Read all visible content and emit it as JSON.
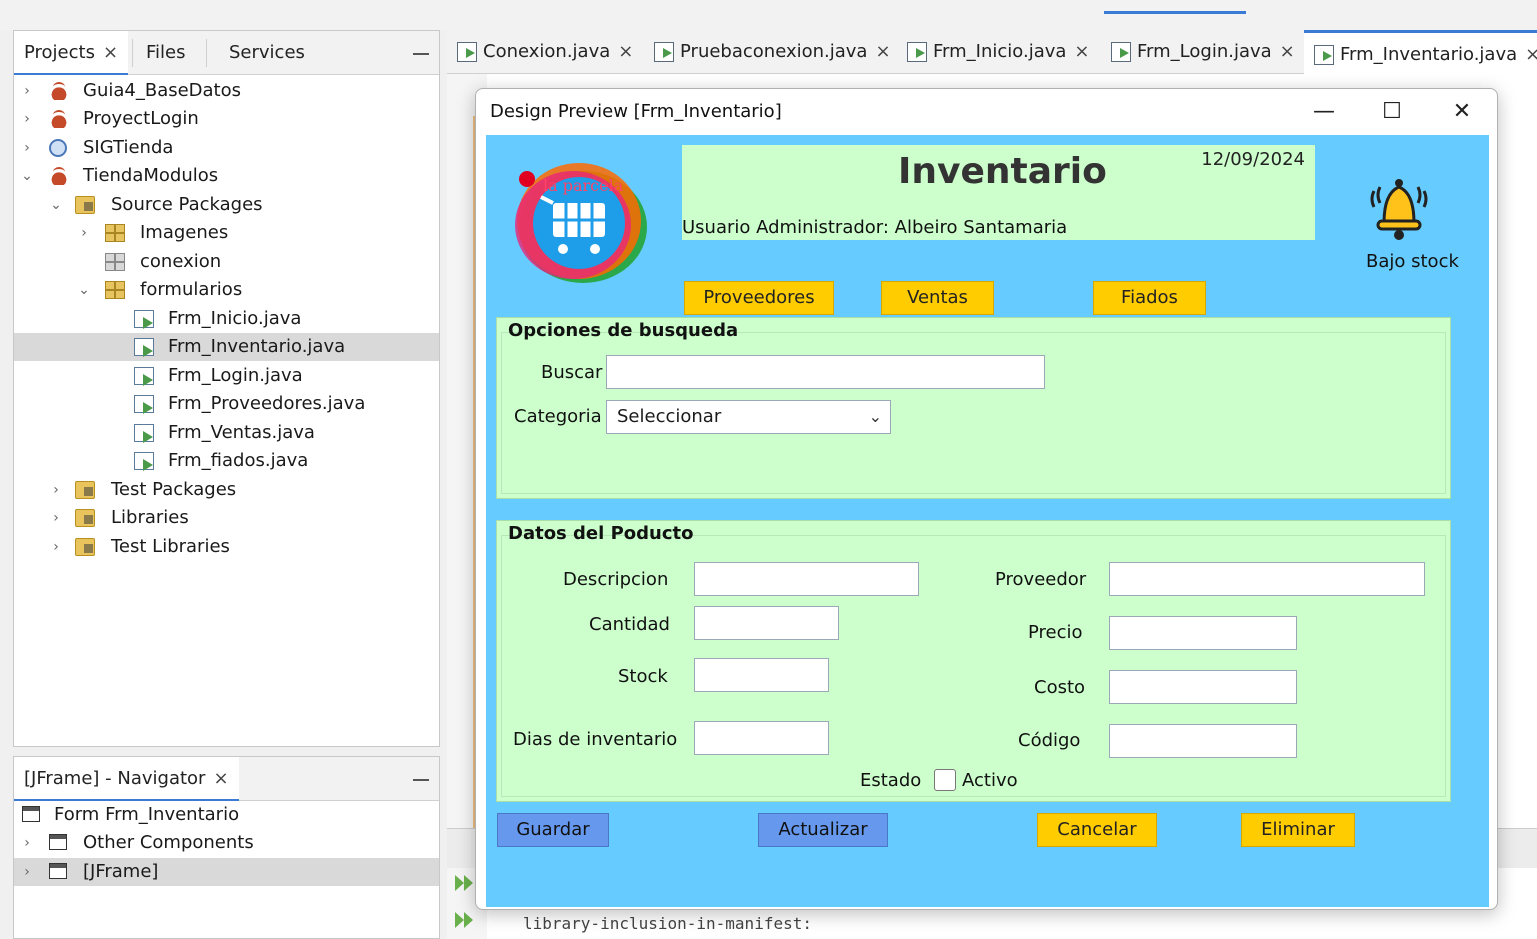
{
  "projects_panel": {
    "tabs": [
      {
        "label": "Projects",
        "close": "×"
      },
      {
        "label": "Files"
      },
      {
        "label": "Services"
      }
    ],
    "tree": [
      {
        "label": "Guia4_BaseDatos"
      },
      {
        "label": "ProyectLogin"
      },
      {
        "label": "SIGTienda"
      },
      {
        "label": "TiendaModulos"
      },
      {
        "label": "Source Packages"
      },
      {
        "label": "Imagenes"
      },
      {
        "label": "conexion"
      },
      {
        "label": "formularios"
      },
      {
        "label": "Frm_Inicio.java"
      },
      {
        "label": "Frm_Inventario.java"
      },
      {
        "label": "Frm_Login.java"
      },
      {
        "label": "Frm_Proveedores.java"
      },
      {
        "label": "Frm_Ventas.java"
      },
      {
        "label": "Frm_fiados.java"
      },
      {
        "label": "Test Packages"
      },
      {
        "label": "Libraries"
      },
      {
        "label": "Test Libraries"
      }
    ]
  },
  "navigator": {
    "title": "[JFrame] - Navigator",
    "close": "×",
    "items": [
      {
        "label": "Form Frm_Inventario"
      },
      {
        "label": "Other Components"
      },
      {
        "label": "[JFrame]"
      }
    ]
  },
  "editor": {
    "tabs": [
      {
        "label": "Conexion.java",
        "close": "×"
      },
      {
        "label": "Pruebaconexion.java",
        "close": "×"
      },
      {
        "label": "Frm_Inicio.java",
        "close": "×"
      },
      {
        "label": "Frm_Login.java",
        "close": "×"
      },
      {
        "label": "Frm_Inventario.java",
        "close": "×"
      }
    ],
    "output_line": "library-inclusion-in-manifest:"
  },
  "preview": {
    "title": "Design Preview [Frm_Inventario]",
    "controls": {
      "minimize": "—",
      "maximize": "☐",
      "close": "✕"
    },
    "logo_text": "la parcela",
    "form_title": "Inventario",
    "date": "12/09/2024",
    "user_label": "Usuario Administrador: Albeiro  Santamaria",
    "bajo_stock": "Bajo stock",
    "nav_buttons": {
      "proveedores": "Proveedores",
      "ventas": "Ventas",
      "fiados": "Fiados"
    },
    "search_group": {
      "title": "Opciones de busqueda",
      "buscar_label": "Buscar",
      "buscar_value": "",
      "categoria_label": "Categoria",
      "categoria_selected": "Seleccionar"
    },
    "product_group": {
      "title": "Datos del Poducto",
      "descripcion": "Descripcion",
      "cantidad": "Cantidad",
      "stock": "Stock",
      "dias": "Dias de inventario",
      "proveedor": "Proveedor",
      "precio": "Precio",
      "costo": "Costo",
      "codigo": "Código",
      "estado": "Estado",
      "activo": "Activo"
    },
    "actions": {
      "guardar": "Guardar",
      "actualizar": "Actualizar",
      "cancelar": "Cancelar",
      "eliminar": "Eliminar"
    },
    "colors": {
      "background": "#66ccff",
      "panel": "#ccffcc",
      "yellow_button": "#ffcc00",
      "blue_button": "#6699ee"
    }
  }
}
